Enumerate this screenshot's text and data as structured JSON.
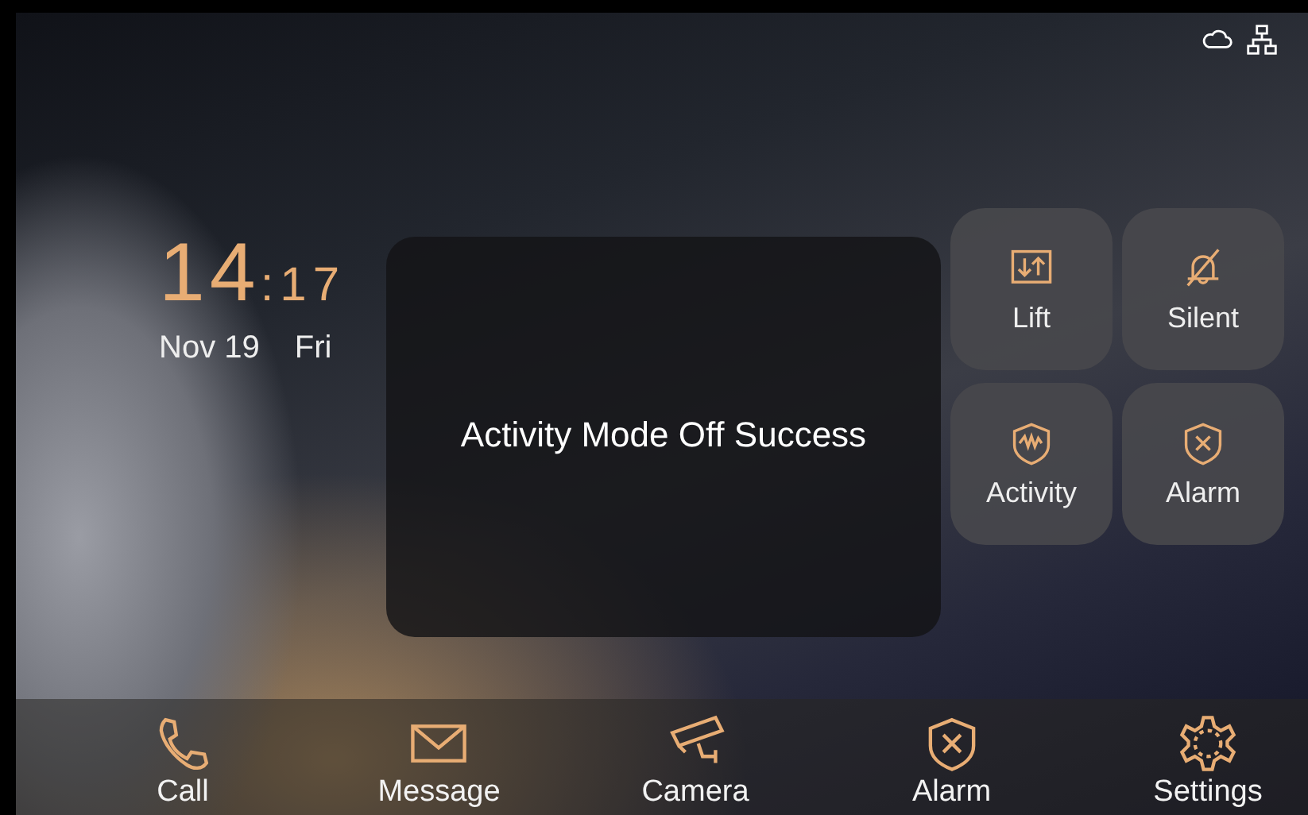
{
  "clock": {
    "hours": "14",
    "minutes": ":17",
    "date": "Nov 19",
    "weekday": "Fri"
  },
  "toast": {
    "message": "Activity Mode Off Success"
  },
  "quick_actions": [
    {
      "label": "Lift",
      "kind": "lift"
    },
    {
      "label": "Silent",
      "kind": "silent"
    },
    {
      "label": "Activity",
      "kind": "activity"
    },
    {
      "label": "Alarm",
      "kind": "alarm"
    }
  ],
  "dock": [
    {
      "label": "Call",
      "kind": "call"
    },
    {
      "label": "Message",
      "kind": "message"
    },
    {
      "label": "Camera",
      "kind": "camera"
    },
    {
      "label": "Alarm",
      "kind": "alarm"
    },
    {
      "label": "Settings",
      "kind": "settings"
    }
  ]
}
